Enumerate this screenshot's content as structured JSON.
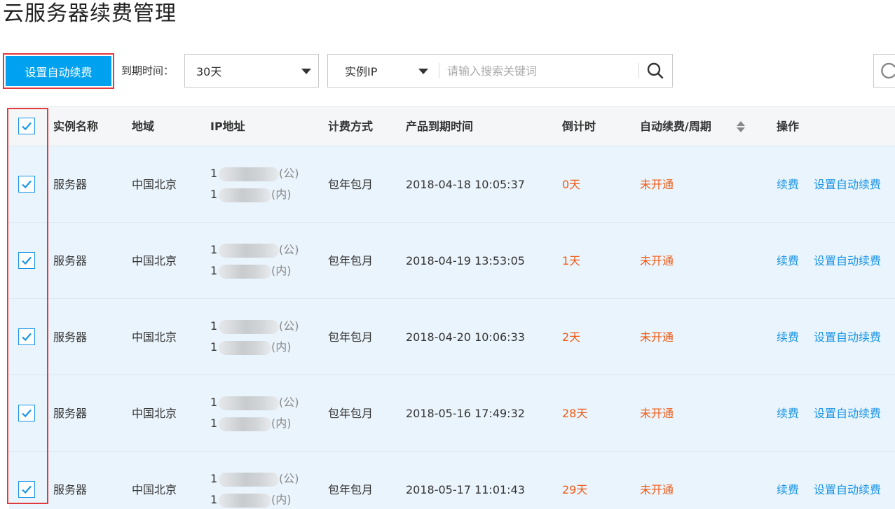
{
  "page": {
    "title": "云服务器续费管理"
  },
  "toolbar": {
    "auto_renew_button": "设置自动续费",
    "expire_label": "到期时间：",
    "expire_select_value": "30天",
    "search_type_value": "实例IP",
    "search_placeholder": "请输入搜索关键词",
    "search_icon": "search-icon",
    "refresh_icon": "refresh-icon"
  },
  "table": {
    "headers": {
      "name": "实例名称",
      "region": "地域",
      "ip": "IP地址",
      "billing": "计费方式",
      "expire_time": "产品到期时间",
      "countdown": "倒计时",
      "auto_renew": "自动续费/周期",
      "actions": "操作"
    },
    "select_all_checked": true,
    "rows": [
      {
        "checked": true,
        "name": "服务器",
        "region": "中国北京",
        "ip_public_prefix": "1",
        "ip_public_suffix": "(公)",
        "ip_private_prefix": "1",
        "ip_private_suffix": "(内)",
        "billing": "包年包月",
        "expire_time": "2018-04-18 10:05:37",
        "countdown": "0天",
        "auto_renew": "未开通",
        "action_renew": "续费",
        "action_auto": "设置自动续费"
      },
      {
        "checked": true,
        "name": "服务器",
        "region": "中国北京",
        "ip_public_prefix": "1",
        "ip_public_suffix": "(公)",
        "ip_private_prefix": "1",
        "ip_private_suffix": "(内)",
        "billing": "包年包月",
        "expire_time": "2018-04-19 13:53:05",
        "countdown": "1天",
        "auto_renew": "未开通",
        "action_renew": "续费",
        "action_auto": "设置自动续费"
      },
      {
        "checked": true,
        "name": "服务器",
        "region": "中国北京",
        "ip_public_prefix": "1",
        "ip_public_suffix": "(公)",
        "ip_private_prefix": "1",
        "ip_private_suffix": "(内)",
        "billing": "包年包月",
        "expire_time": "2018-04-20 10:06:33",
        "countdown": "2天",
        "auto_renew": "未开通",
        "action_renew": "续费",
        "action_auto": "设置自动续费"
      },
      {
        "checked": true,
        "name": "服务器",
        "region": "中国北京",
        "ip_public_prefix": "1",
        "ip_public_suffix": "(公)",
        "ip_private_prefix": "1",
        "ip_private_suffix": "(内)",
        "billing": "包年包月",
        "expire_time": "2018-05-16 17:49:32",
        "countdown": "28天",
        "auto_renew": "未开通",
        "action_renew": "续费",
        "action_auto": "设置自动续费"
      },
      {
        "checked": true,
        "name": "服务器",
        "region": "中国北京",
        "ip_public_prefix": "1",
        "ip_public_suffix": "(公)",
        "ip_private_prefix": "1",
        "ip_private_suffix": "(内)",
        "billing": "包年包月",
        "expire_time": "2018-05-17 11:01:43",
        "countdown": "29天",
        "auto_renew": "未开通",
        "action_renew": "续费",
        "action_auto": "设置自动续费"
      }
    ]
  },
  "colors": {
    "primary_button": "#00a2f0",
    "highlight_outline": "#e0393e",
    "countdown": "#f05a14",
    "link": "#1a95e6",
    "row_background": "#eaf4fc"
  }
}
